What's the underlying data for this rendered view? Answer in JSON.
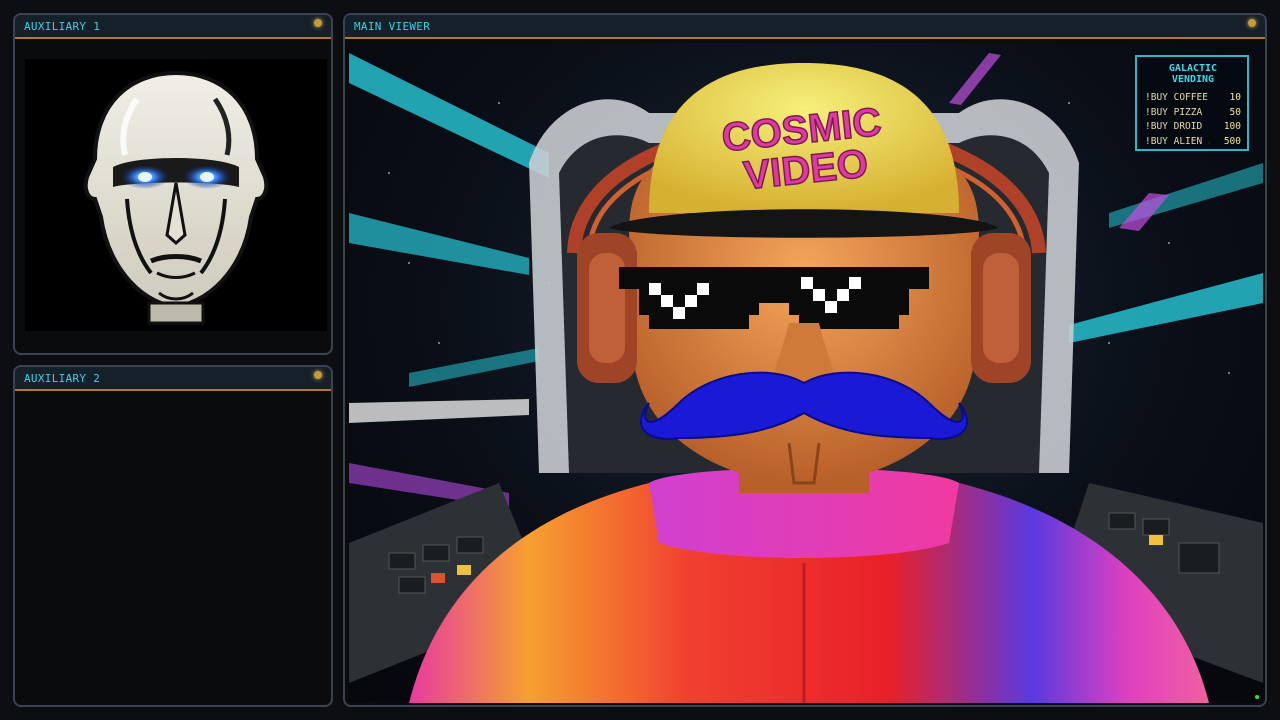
{
  "panels": {
    "aux1": {
      "title": "AUXILIARY 1"
    },
    "aux2": {
      "title": "AUXILIARY 2"
    },
    "main": {
      "title": "MAIN VIEWER"
    }
  },
  "cap_text": {
    "line1": "COSMIC",
    "line2": "VIDEO"
  },
  "vending": {
    "title": "GALACTIC VENDING",
    "items": [
      {
        "command": "!BUY COFFEE",
        "cost": "10"
      },
      {
        "command": "!BUY PIZZA",
        "cost": "50"
      },
      {
        "command": "!BUY DROID",
        "cost": "100"
      },
      {
        "command": "!BUY ALIEN",
        "cost": "500"
      }
    ]
  },
  "colors": {
    "panel_title": "#3fd0e0",
    "header_accent": "#b47a2a",
    "vending_border": "#2fb6c8",
    "status_led": "#c89a3a"
  }
}
